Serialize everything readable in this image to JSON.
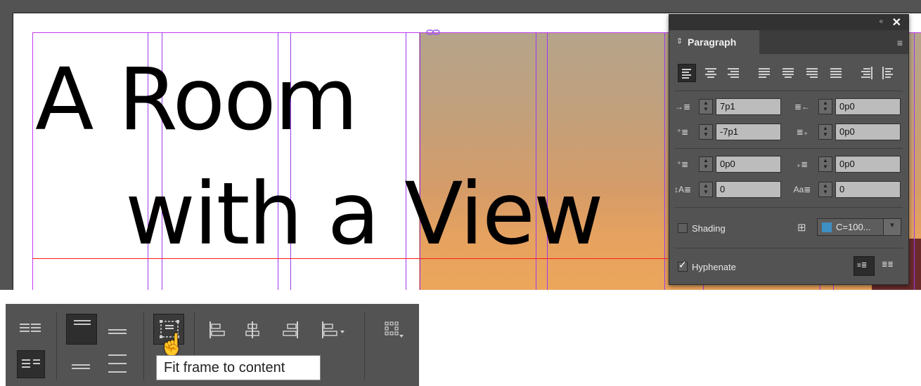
{
  "document": {
    "headline_line1": "A Room",
    "headline_line2": "with a View",
    "link_icon": "chain-link-icon"
  },
  "paragraph_panel": {
    "tab_label": "Paragraph",
    "icons": {
      "collapse": "«",
      "close": "✕",
      "menu": "≡",
      "tab_arrows": "⇕"
    },
    "alignment_buttons": [
      "align-left",
      "align-center",
      "align-right",
      "justify-left",
      "justify-center",
      "justify-right",
      "justify-all",
      "align-towards-spine",
      "align-away-from-spine"
    ],
    "active_alignment": "align-left",
    "fields": {
      "left_indent": "7p1",
      "right_indent": "0p0",
      "first_line_indent": "-7p1",
      "last_line_right_indent": "0p0",
      "space_before": "0p0",
      "space_after": "0p0",
      "drop_cap_lines": "0",
      "drop_cap_chars": "0"
    },
    "shading_label": "Shading",
    "shading_checked": false,
    "shading_color_label": "C=100...",
    "shading_color_swatch": "#3d8fc4",
    "hyphenate_label": "Hyphenate",
    "hyphenate_checked": true
  },
  "control_bar": {
    "tooltip": "Fit frame to content",
    "buttons": [
      "balance-columns",
      "align-top",
      "align-center-vertical",
      "align-bottom",
      "justify-vertical",
      "fit-frame-to-content",
      "align-left-edges",
      "align-horizontal-centers",
      "align-right-edges",
      "distribute-options",
      "more-options"
    ]
  },
  "colors": {
    "panel_bg": "#535353",
    "guide_magenta": "#c23bf0",
    "guide_red": "#ff1a1a"
  }
}
